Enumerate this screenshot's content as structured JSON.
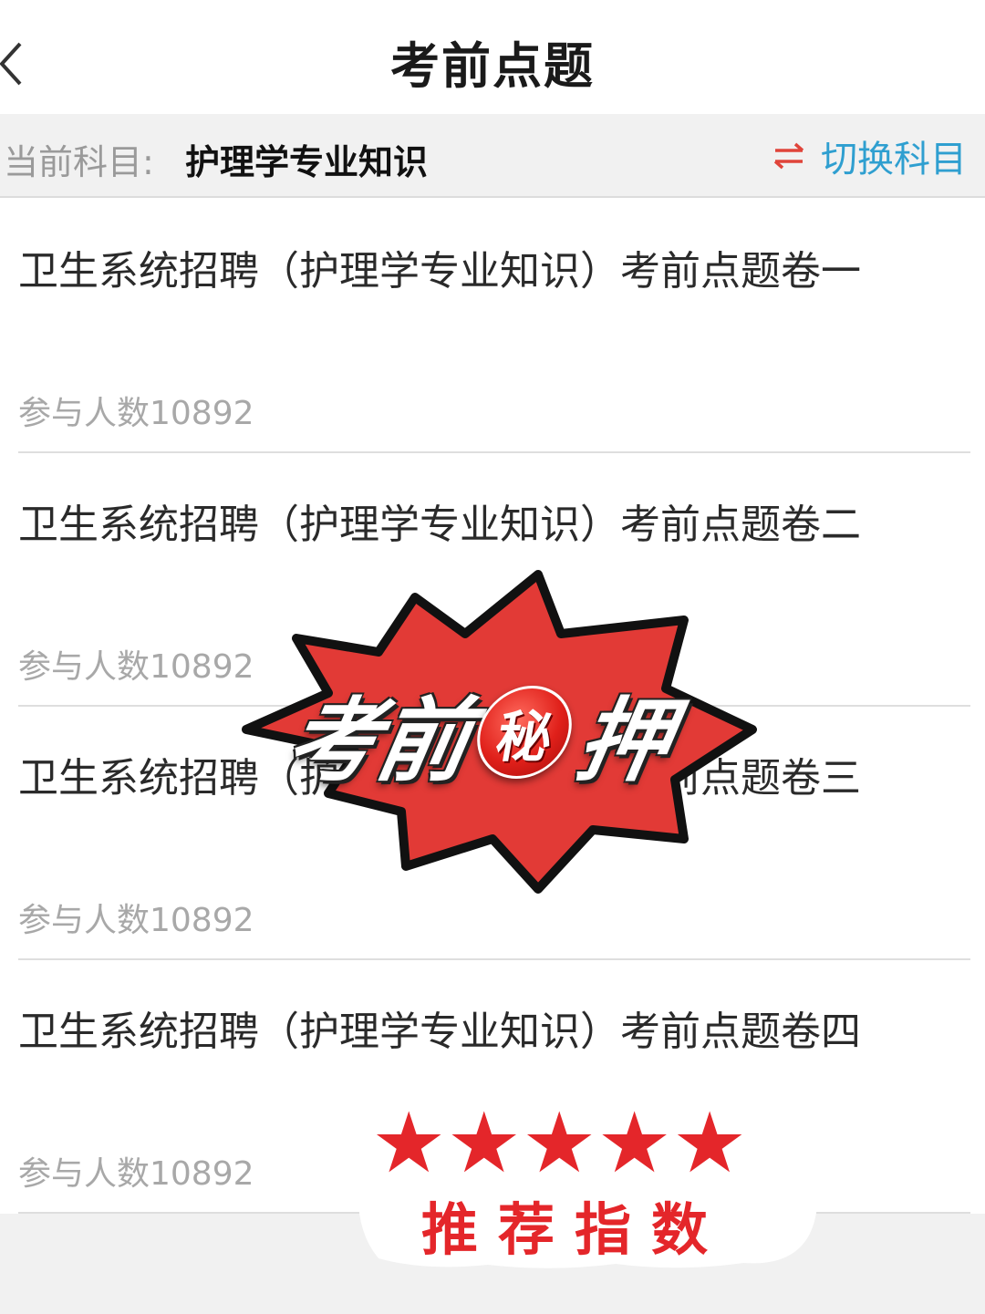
{
  "header": {
    "title": "考前点题",
    "back_icon": "chevron-left-icon"
  },
  "subject": {
    "label": "当前科目:",
    "value": "护理学专业知识",
    "switch_label": "切换科目",
    "switch_icon": "swap-arrows-icon",
    "switch_icon_color": "#e0443a",
    "switch_label_color": "#2f9fd0"
  },
  "papers": [
    {
      "title": "卫生系统招聘（护理学专业知识）考前点题卷一",
      "count": "参与人数10892"
    },
    {
      "title": "卫生系统招聘（护理学专业知识）考前点题卷二",
      "count": "参与人数10892"
    },
    {
      "title": "卫生系统招聘（护理学专业知识）考前点题卷三",
      "count": "参与人数10892"
    },
    {
      "title": "卫生系统招聘（护理学专业知识）考前点题卷四",
      "count": "参与人数10892"
    }
  ],
  "overlay": {
    "stamp_text_1": "考前",
    "stamp_seal": "秘",
    "stamp_text_2": "押",
    "stamp_color": "#e23a36",
    "rating_stars": "★★★★★",
    "rating_label": "推荐指数",
    "rating_color": "#e4262a"
  }
}
